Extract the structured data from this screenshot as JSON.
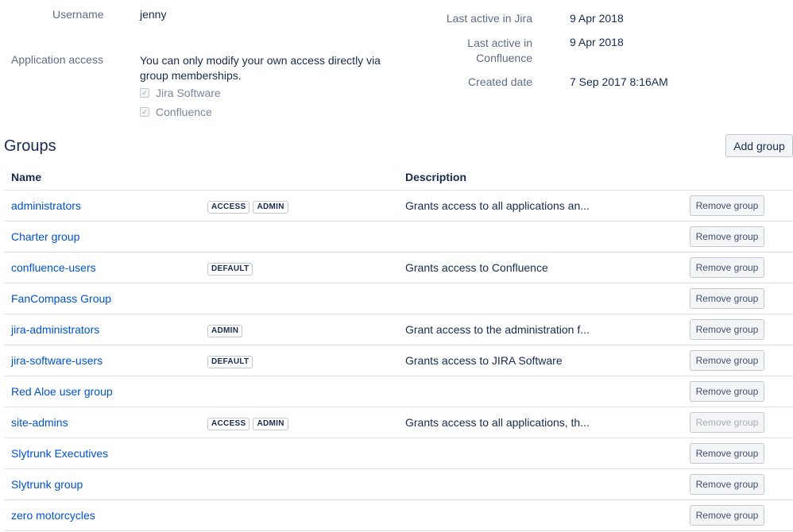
{
  "profile": {
    "username_label": "Username",
    "username_value": "jenny",
    "app_access_label": "Application access",
    "app_access_note_line1": "You can only modify your own access directly via",
    "app_access_note_line2": "group memberships.",
    "apps": [
      "Jira Software",
      "Confluence"
    ],
    "last_active_jira_label": "Last active in Jira",
    "last_active_jira_value": "9 Apr 2018",
    "last_active_conf_label_line1": "Last active in",
    "last_active_conf_label_line2": "Confluence",
    "last_active_conf_value": "9 Apr 2018",
    "created_label": "Created date",
    "created_value": "7 Sep 2017 8:16AM"
  },
  "groups": {
    "title": "Groups",
    "add_label": "Add group",
    "columns": {
      "name": "Name",
      "description": "Description"
    },
    "remove_label": "Remove group",
    "rows": [
      {
        "name": "administrators",
        "badges": [
          "ACCESS",
          "ADMIN"
        ],
        "description": "Grants access to all applications an...",
        "remove_disabled": false
      },
      {
        "name": "Charter group",
        "badges": [],
        "description": "",
        "remove_disabled": false
      },
      {
        "name": "confluence-users",
        "badges": [
          "DEFAULT"
        ],
        "description": "Grants access to Confluence",
        "remove_disabled": false
      },
      {
        "name": "FanCompass Group",
        "badges": [],
        "description": "",
        "remove_disabled": false
      },
      {
        "name": "jira-administrators",
        "badges": [
          "ADMIN"
        ],
        "description": "Grant access to the administration f...",
        "remove_disabled": false
      },
      {
        "name": "jira-software-users",
        "badges": [
          "DEFAULT"
        ],
        "description": "Grants access to JIRA Software",
        "remove_disabled": false
      },
      {
        "name": "Red Aloe user group",
        "badges": [],
        "description": "",
        "remove_disabled": false
      },
      {
        "name": "site-admins",
        "badges": [
          "ACCESS",
          "ADMIN"
        ],
        "description": "Grants access to all applications, th...",
        "remove_disabled": true
      },
      {
        "name": "Slytrunk Executives",
        "badges": [],
        "description": "",
        "remove_disabled": false
      },
      {
        "name": "Slytrunk group",
        "badges": [],
        "description": "",
        "remove_disabled": false
      },
      {
        "name": "zero motorcycles",
        "badges": [],
        "description": "",
        "remove_disabled": false
      }
    ]
  }
}
